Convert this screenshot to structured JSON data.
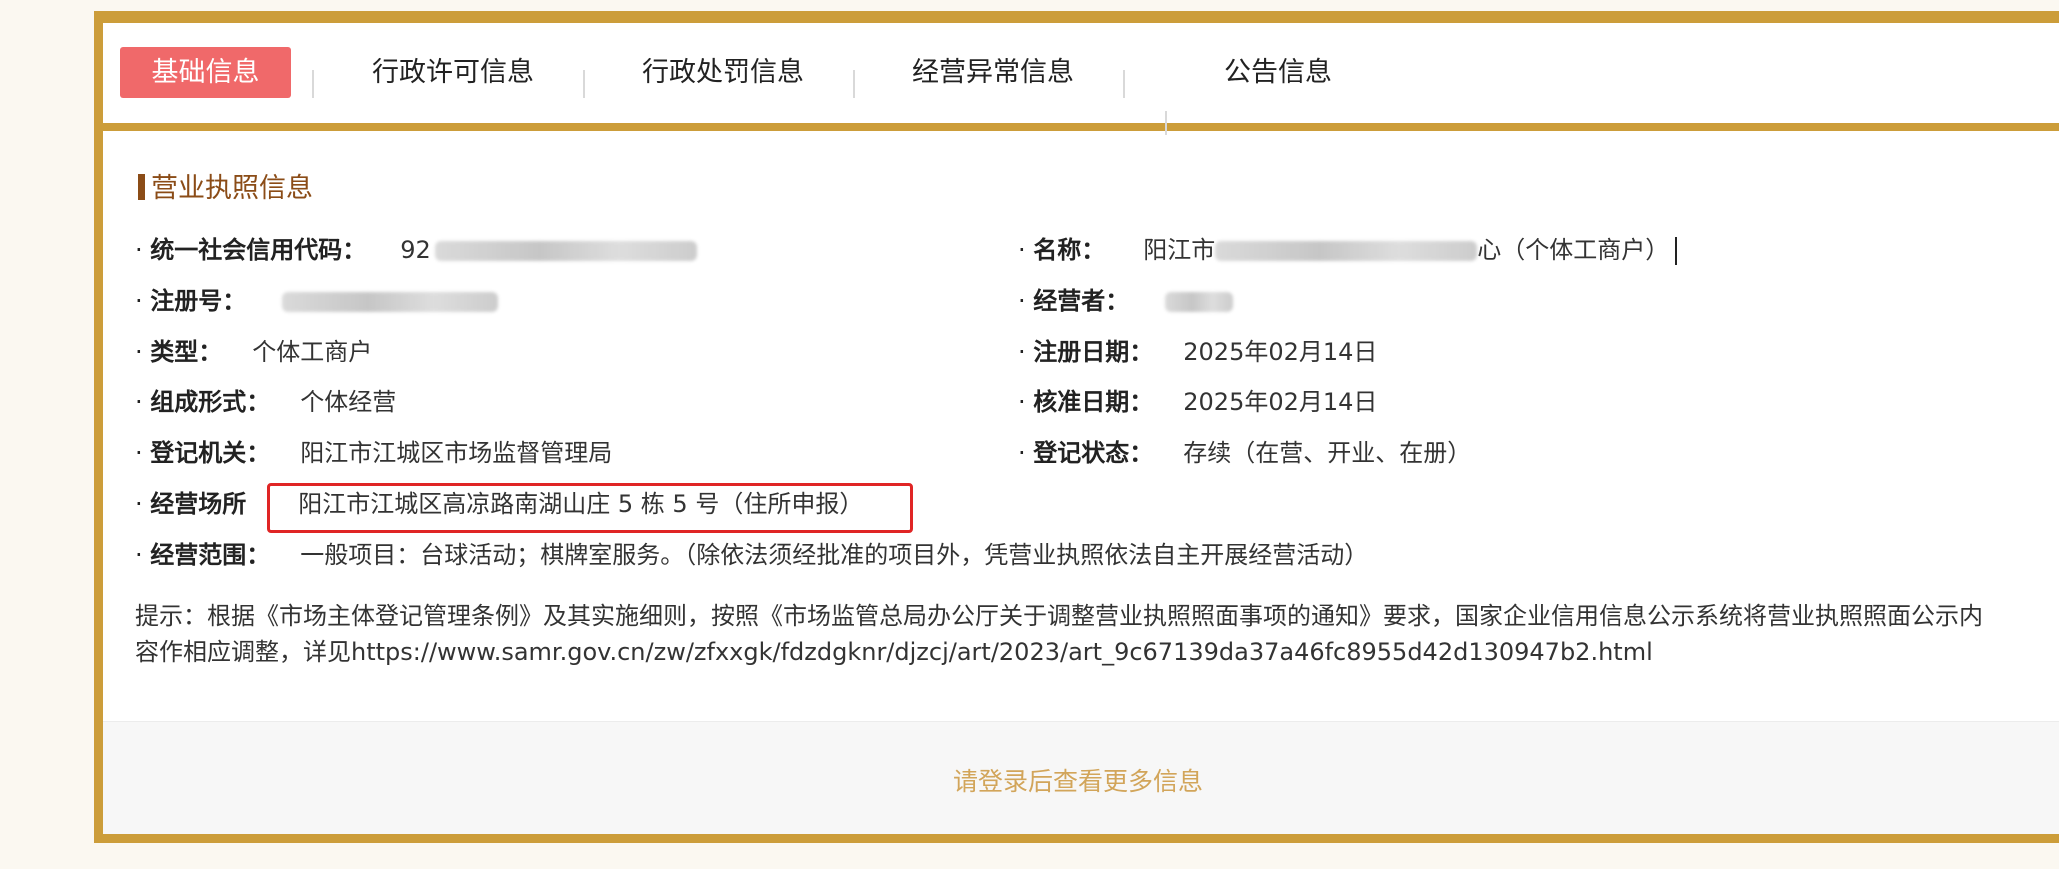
{
  "tabs": [
    {
      "label": "基础信息",
      "active": true
    },
    {
      "label": "行政许可信息",
      "active": false
    },
    {
      "label": "行政处罚信息",
      "active": false
    },
    {
      "label": "经营异常信息",
      "active": false
    },
    {
      "label": "公告信息",
      "active": false
    }
  ],
  "section": {
    "title": "营业执照信息"
  },
  "fields": {
    "credit_code": {
      "label": "统一社会信用代码：",
      "value": "92"
    },
    "name": {
      "label": "名称：",
      "value_prefix": "阳江市",
      "value_suffix": "心（个体工商户）"
    },
    "reg_no": {
      "label": "注册号："
    },
    "operator": {
      "label": "经营者："
    },
    "type": {
      "label": "类型：",
      "value": "个体工商户"
    },
    "reg_date": {
      "label": "注册日期：",
      "value": "2025年02月14日"
    },
    "form": {
      "label": "组成形式：",
      "value": "个体经营"
    },
    "approve_date": {
      "label": "核准日期：",
      "value": "2025年02月14日"
    },
    "authority": {
      "label": "登记机关：",
      "value": "阳江市江城区市场监督管理局"
    },
    "status": {
      "label": "登记状态：",
      "value": "存续（在营、开业、在册）"
    },
    "address": {
      "label": "经营场所",
      "value": "阳江市江城区高凉路南湖山庄 5 栋 5 号（住所申报）"
    },
    "scope": {
      "label": "经营范围：",
      "value": "一般项目：台球活动；棋牌室服务。（除依法须经批准的项目外，凭营业执照依法自主开展经营活动）"
    }
  },
  "hint": "提示：根据《市场主体登记管理条例》及其实施细则，按照《市场监管总局办公厅关于调整营业执照照面事项的通知》要求，国家企业信用信息公示系统将营业执照照面公示内容作相应调整，详见https://www.samr.gov.cn/zw/zfxxgk/fdzdgknr/djzcj/art/2023/art_9c67139da37a46fc8955d42d130947b2.html",
  "footer": {
    "login_link": "请登录后查看更多信息"
  },
  "colors": {
    "accent": "#cc9d3a",
    "active_tab": "#f0696a",
    "section_title": "#8b4c17",
    "highlight": "#e02525",
    "footer_link": "#d2a55a"
  }
}
